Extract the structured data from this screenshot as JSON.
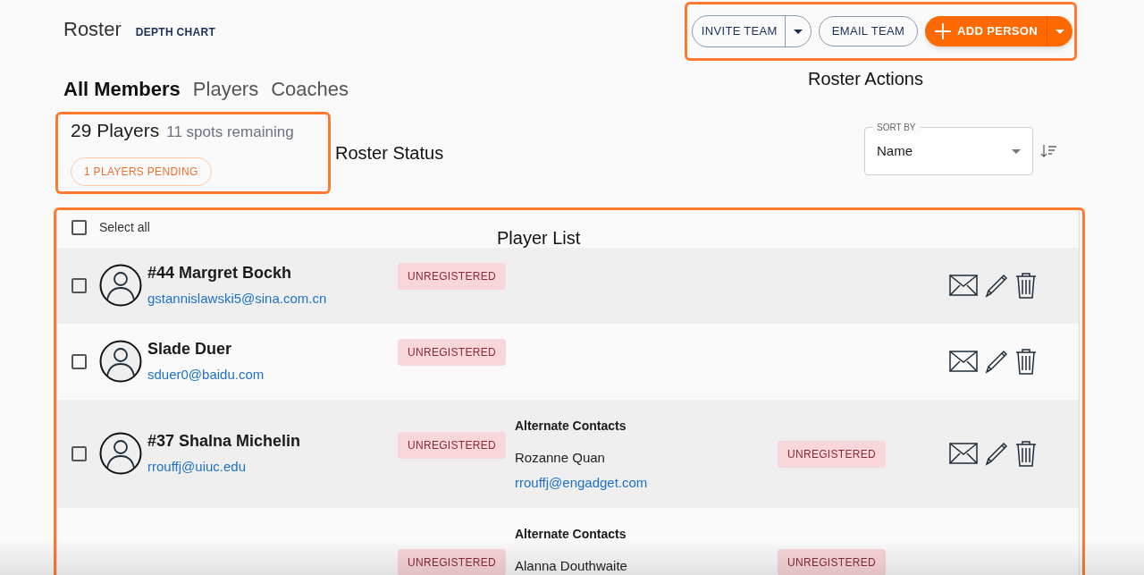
{
  "header": {
    "title": "Roster",
    "link": "DEPTH CHART"
  },
  "actions": {
    "invite": "INVITE TEAM",
    "email": "EMAIL TEAM",
    "add": "ADD PERSON"
  },
  "tabs": [
    {
      "label": "All Members",
      "selected": true
    },
    {
      "label": "Players",
      "selected": false
    },
    {
      "label": "Coaches",
      "selected": false
    }
  ],
  "status": {
    "count": "29 Players",
    "remaining": "11 spots remaining",
    "pending": "1 PLAYERS PENDING"
  },
  "sort": {
    "label": "SORT BY",
    "value": "Name"
  },
  "list": {
    "select_all": {
      "label": "Select all",
      "checked": false
    },
    "rows": [
      {
        "name": "#44 Margret Bockh",
        "email": "gstannislawski5@sina.com.cn",
        "badge": "UNREGISTERED",
        "checked": false
      },
      {
        "name": "Slade Duer",
        "email": "sduer0@baidu.com",
        "badge": "UNREGISTERED",
        "checked": false
      },
      {
        "name": "#37 Shalna Michelin",
        "email": "rrouffj@uiuc.edu",
        "badge": "UNREGISTERED",
        "checked": false,
        "alternate_contacts": {
          "heading": "Alternate Contacts",
          "name": "Rozanne Quan",
          "email": "rrouffj@engadget.com",
          "badge": "UNREGISTERED"
        }
      },
      {
        "badge": "UNREGISTERED",
        "alternate_contacts": {
          "heading": "Alternate Contacts",
          "name": "Alanna Douthwaite",
          "badge": "UNREGISTERED"
        }
      }
    ]
  },
  "annotations": [
    {
      "kind": "actions",
      "label": "Roster Actions"
    },
    {
      "kind": "status",
      "label": "Roster Status"
    },
    {
      "kind": "list",
      "label": "Player List"
    }
  ]
}
